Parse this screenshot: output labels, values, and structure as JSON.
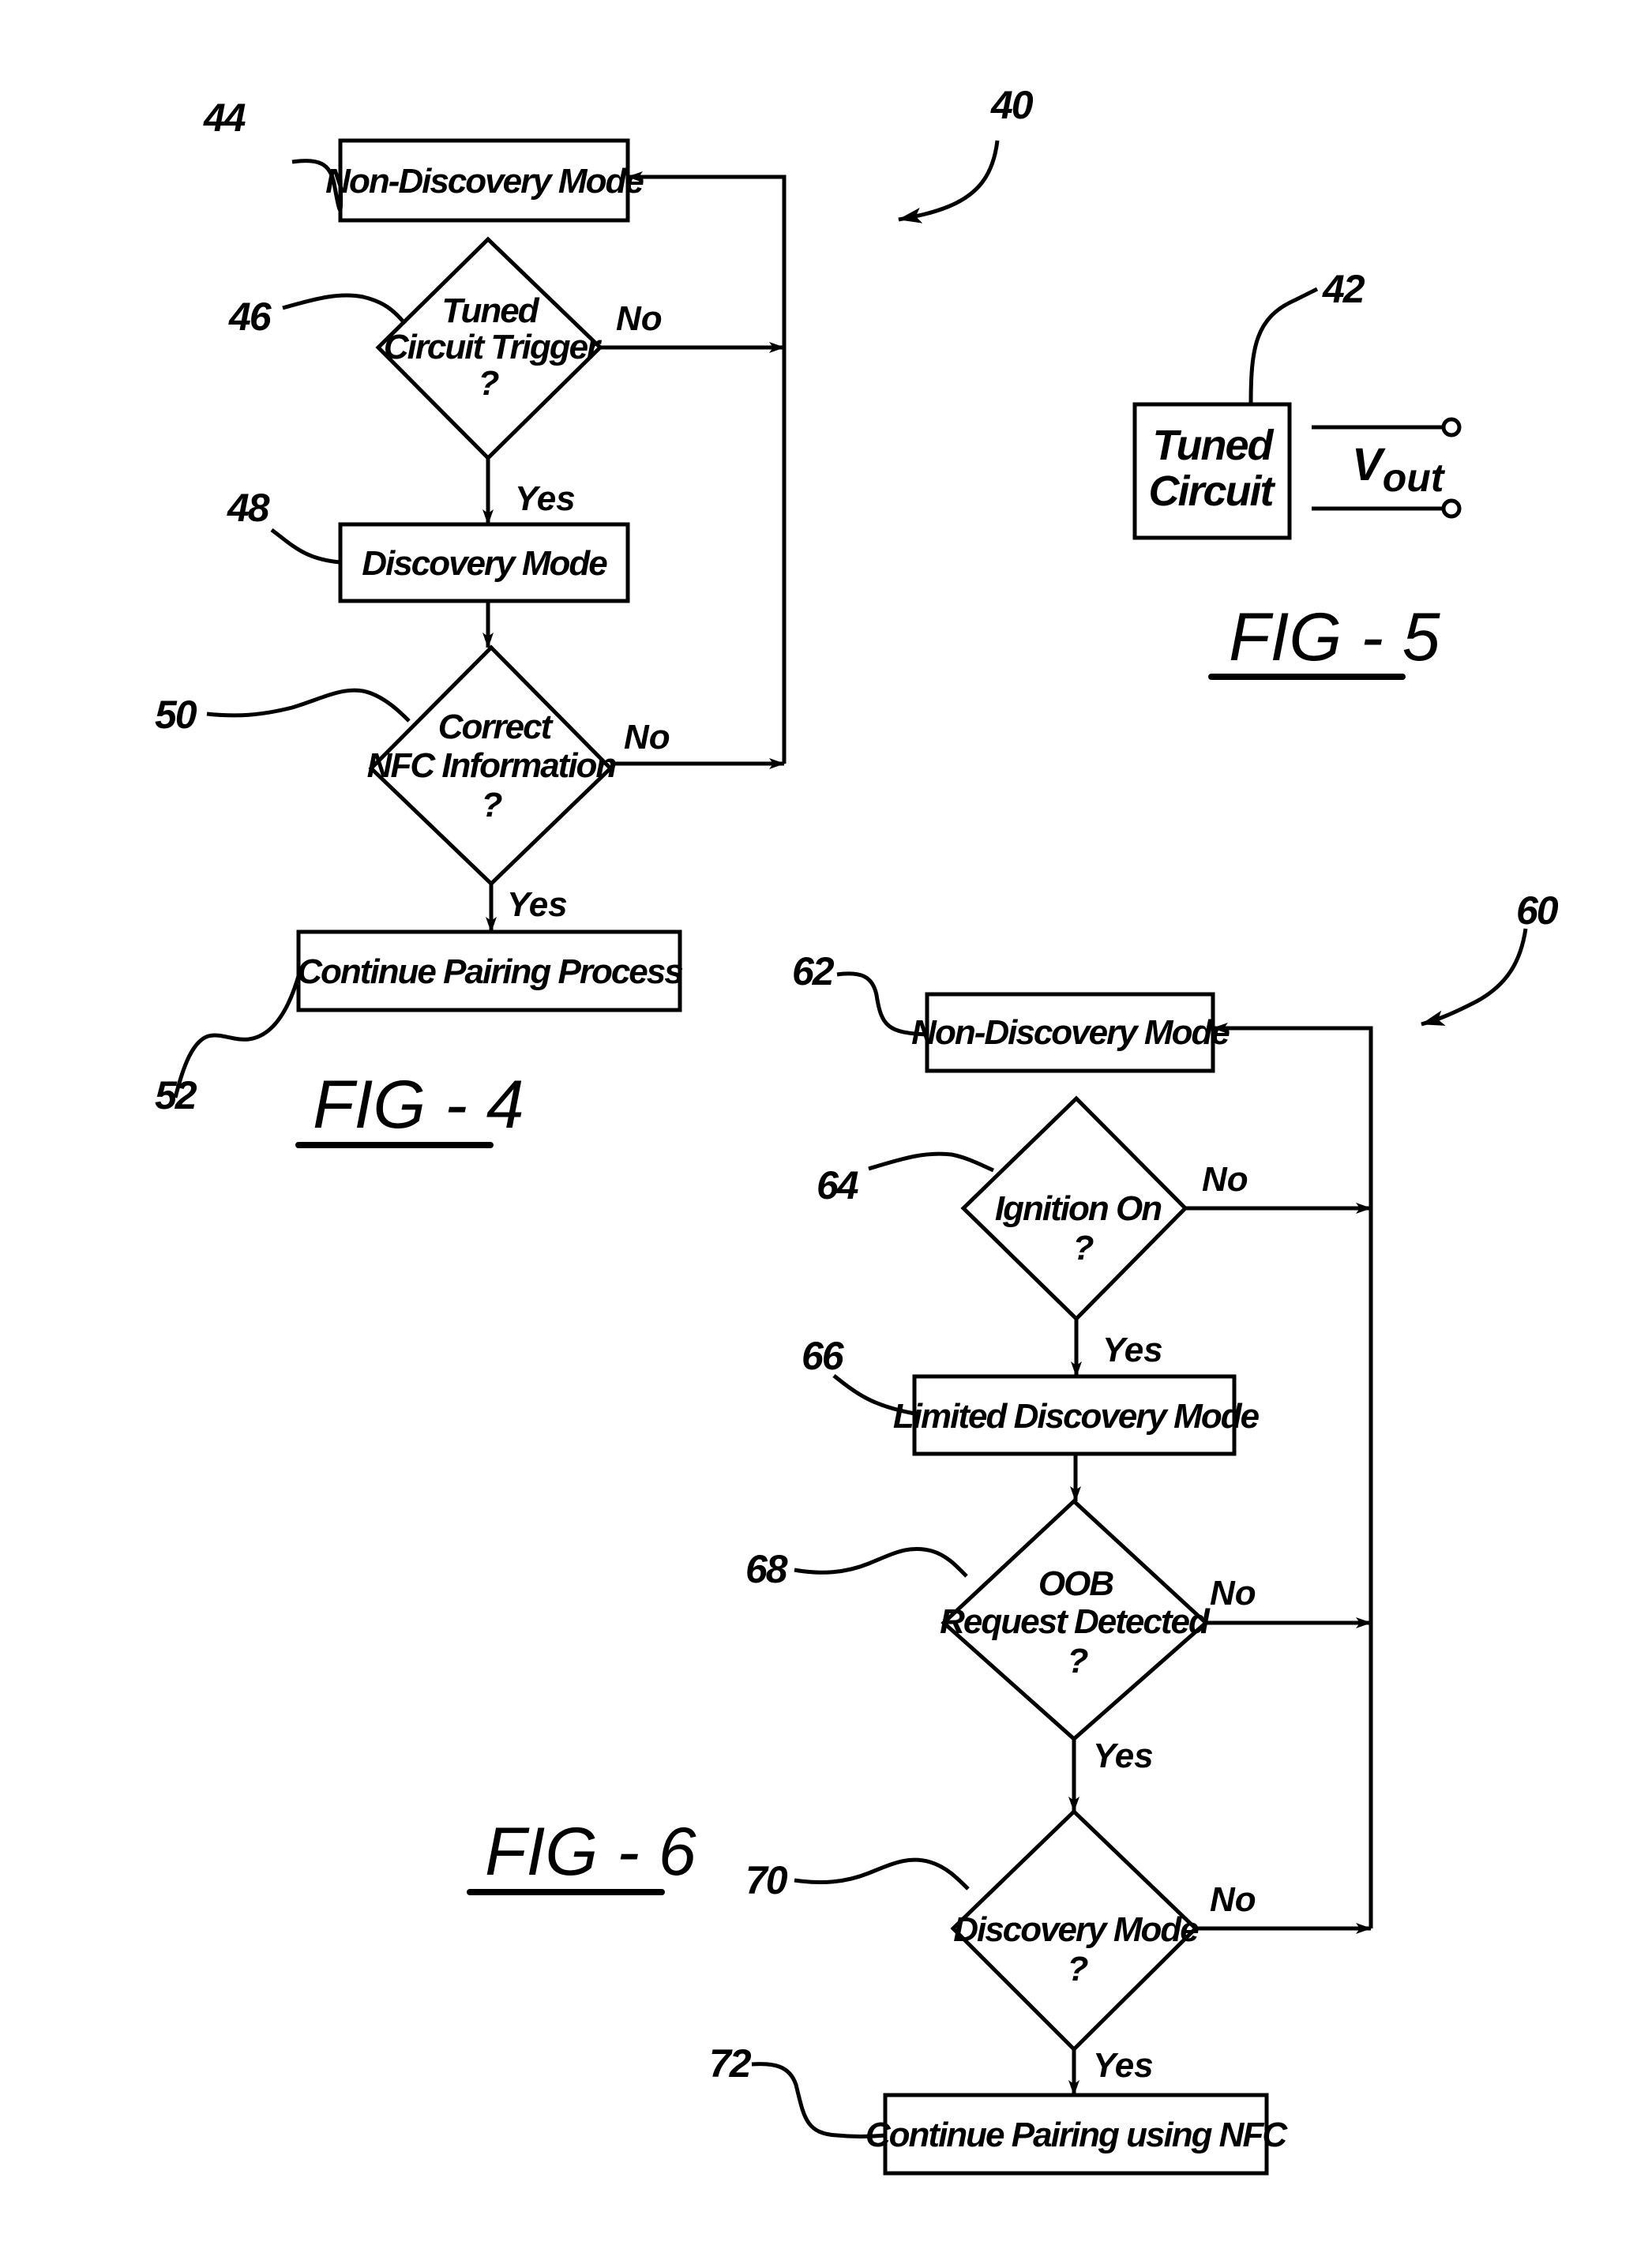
{
  "sheet": {
    "figures": {
      "fig4": {
        "label": "FIG - 4",
        "ref": "40",
        "nodes": {
          "n44": {
            "ref": "44",
            "type": "process",
            "text": "Non-Discovery Mode"
          },
          "n46": {
            "ref": "46",
            "type": "decision",
            "lines": [
              "Tuned",
              "Circuit Trigger",
              "?"
            ]
          },
          "n48": {
            "ref": "48",
            "type": "process",
            "text": "Discovery Mode"
          },
          "n50": {
            "ref": "50",
            "type": "decision",
            "lines": [
              "Correct",
              "NFC Information",
              "?"
            ]
          },
          "n52": {
            "ref": "52",
            "type": "process",
            "text": "Continue Pairing Process"
          }
        },
        "edges": {
          "e46_no": "No",
          "e46_yes": "Yes",
          "e50_no": "No",
          "e50_yes": "Yes"
        }
      },
      "fig5": {
        "label": "FIG - 5",
        "component": {
          "ref": "42",
          "lines": [
            "Tuned",
            "Circuit"
          ]
        },
        "output": {
          "symbol": "V",
          "subscript": "out"
        }
      },
      "fig6": {
        "label": "FIG - 6",
        "ref": "60",
        "nodes": {
          "n62": {
            "ref": "62",
            "type": "process",
            "text": "Non-Discovery Mode"
          },
          "n64": {
            "ref": "64",
            "type": "decision",
            "lines": [
              "Ignition On",
              "?"
            ]
          },
          "n66": {
            "ref": "66",
            "type": "process",
            "text": "Limited Discovery Mode"
          },
          "n68": {
            "ref": "68",
            "type": "decision",
            "lines": [
              "OOB",
              "Request Detected",
              "?"
            ]
          },
          "n70": {
            "ref": "70",
            "type": "decision",
            "lines": [
              "Discovery Mode",
              "?"
            ]
          },
          "n72": {
            "ref": "72",
            "type": "process",
            "text": "Continue Pairing using NFC"
          }
        },
        "edges": {
          "e64_no": "No",
          "e64_yes": "Yes",
          "e68_no": "No",
          "e68_yes": "Yes",
          "e70_no": "No",
          "e70_yes": "Yes"
        }
      }
    }
  }
}
